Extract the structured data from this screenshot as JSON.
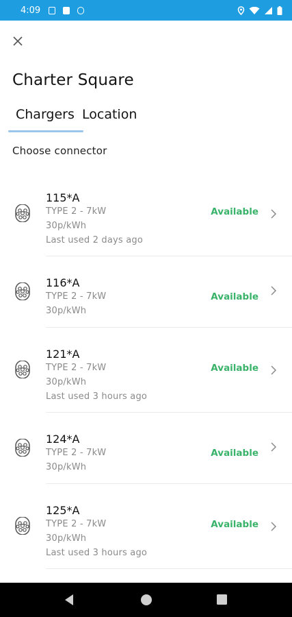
{
  "status_bar": {
    "time": "4:09",
    "left_icons": [
      "font-icon",
      "sim-card-icon",
      "database-icon"
    ],
    "right_icons": [
      "location-icon",
      "wifi-icon",
      "signal-icon",
      "battery-icon"
    ],
    "color": "#1e9de0"
  },
  "header": {
    "close_icon": "close-icon",
    "title": "Charter Square"
  },
  "tabs": [
    {
      "label": "Chargers",
      "active": true
    },
    {
      "label": "Location",
      "active": false
    }
  ],
  "section_label": "Choose connector",
  "chargers": [
    {
      "name": "115*A",
      "type": "TYPE 2 - 7kW",
      "price": "30p/kWh",
      "last_used": "Last used 2 days ago",
      "status": "Available"
    },
    {
      "name": "116*A",
      "type": "TYPE 2 - 7kW",
      "price": "30p/kWh",
      "last_used": null,
      "status": "Available"
    },
    {
      "name": "121*A",
      "type": "TYPE 2 - 7kW",
      "price": "30p/kWh",
      "last_used": "Last used 3 hours ago",
      "status": "Available"
    },
    {
      "name": "124*A",
      "type": "TYPE 2 - 7kW",
      "price": "30p/kWh",
      "last_used": null,
      "status": "Available"
    },
    {
      "name": "125*A",
      "type": "TYPE 2 - 7kW",
      "price": "30p/kWh",
      "last_used": "Last used 3 hours ago",
      "status": "Available"
    }
  ],
  "colors": {
    "available": "#3ab36a",
    "tab_indicator": "#9cc5ec",
    "secondary_text": "#8a8a8a"
  },
  "nav_bar": {
    "buttons": [
      "back-icon",
      "home-icon",
      "recents-icon"
    ]
  }
}
